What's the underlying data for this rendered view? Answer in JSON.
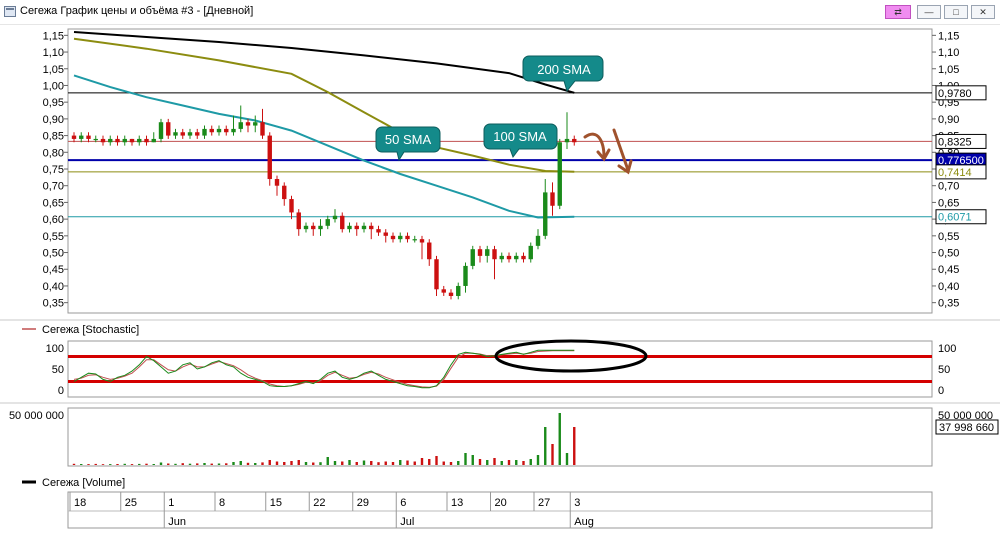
{
  "window": {
    "title": "Сегежа График цены и объёма #3 - [Дневной]",
    "buttons": {
      "link": "⇄",
      "minimize": "—",
      "maximize": "□",
      "close": "✕"
    }
  },
  "panels": {
    "stochastic_label": "Сегежа [Stochastic]",
    "volume_label": "Сегежа [Volume]"
  },
  "annotations": {
    "sma200": "200 SMA",
    "sma100": "100 SMA",
    "sma50": "50 SMA"
  },
  "colors": {
    "bull": "#1a8a1a",
    "bear": "#cc1010",
    "sma200": "#000000",
    "sma100": "#8c8c10",
    "sma50": "#1e9aa6",
    "blue_line": "#0000aa",
    "callout": "#148a8a",
    "stoch_band": "#d40000",
    "arrows": "#a0522d"
  },
  "chart_data": [
    {
      "type": "candlestick",
      "y_ticks": [
        "1,15",
        "1,10",
        "1,05",
        "1,00",
        "0,95",
        "0,90",
        "0,85",
        "0,80",
        "0,75",
        "0,70",
        "0,65",
        "0,60",
        "0,55",
        "0,50",
        "0,45",
        "0,40",
        "0,35"
      ],
      "ylim": [
        0.34,
        1.16
      ],
      "price_labels": [
        {
          "text": "0,9780",
          "value": 0.978,
          "color": "#000000",
          "bg": "#ffffff"
        },
        {
          "text": "0,8325",
          "value": 0.8325,
          "color": "#000000",
          "bg": "#ffffff"
        },
        {
          "text": "0,776500",
          "value": 0.7765,
          "color": "#ffffff",
          "bg": "#0000aa"
        },
        {
          "text": "0,7414",
          "value": 0.7414,
          "color": "#8c8c10",
          "bg": "#ffffff"
        },
        {
          "text": "0,6071",
          "value": 0.6071,
          "color": "#1e9aa6",
          "bg": "#ffffff"
        }
      ],
      "h_lines": [
        {
          "value": 0.978,
          "color": "#000000"
        },
        {
          "value": 0.8325,
          "color": "#c05050"
        },
        {
          "value": 0.7765,
          "color": "#0000aa"
        },
        {
          "value": 0.7414,
          "color": "#8c8c10"
        },
        {
          "value": 0.6071,
          "color": "#1e9aa6"
        }
      ],
      "candles": [
        [
          0.85,
          0.84,
          0.86,
          0.83
        ],
        [
          0.84,
          0.85,
          0.86,
          0.83
        ],
        [
          0.85,
          0.84,
          0.86,
          0.83
        ],
        [
          0.84,
          0.84,
          0.85,
          0.83
        ],
        [
          0.84,
          0.83,
          0.85,
          0.82
        ],
        [
          0.83,
          0.84,
          0.85,
          0.82
        ],
        [
          0.84,
          0.83,
          0.85,
          0.82
        ],
        [
          0.83,
          0.84,
          0.85,
          0.82
        ],
        [
          0.84,
          0.83,
          0.84,
          0.82
        ],
        [
          0.83,
          0.84,
          0.85,
          0.82
        ],
        [
          0.84,
          0.83,
          0.85,
          0.82
        ],
        [
          0.83,
          0.84,
          0.86,
          0.83
        ],
        [
          0.84,
          0.89,
          0.9,
          0.83
        ],
        [
          0.89,
          0.85,
          0.9,
          0.84
        ],
        [
          0.85,
          0.86,
          0.87,
          0.84
        ],
        [
          0.86,
          0.85,
          0.87,
          0.84
        ],
        [
          0.85,
          0.86,
          0.87,
          0.84
        ],
        [
          0.86,
          0.85,
          0.87,
          0.84
        ],
        [
          0.85,
          0.87,
          0.88,
          0.84
        ],
        [
          0.87,
          0.86,
          0.88,
          0.85
        ],
        [
          0.86,
          0.87,
          0.88,
          0.85
        ],
        [
          0.87,
          0.86,
          0.88,
          0.85
        ],
        [
          0.86,
          0.87,
          0.91,
          0.85
        ],
        [
          0.87,
          0.89,
          0.94,
          0.86
        ],
        [
          0.89,
          0.88,
          0.9,
          0.86
        ],
        [
          0.88,
          0.89,
          0.91,
          0.86
        ],
        [
          0.89,
          0.85,
          0.93,
          0.84
        ],
        [
          0.85,
          0.72,
          0.86,
          0.7
        ],
        [
          0.72,
          0.7,
          0.73,
          0.67
        ],
        [
          0.7,
          0.66,
          0.71,
          0.64
        ],
        [
          0.66,
          0.62,
          0.67,
          0.6
        ],
        [
          0.62,
          0.57,
          0.63,
          0.55
        ],
        [
          0.57,
          0.58,
          0.59,
          0.56
        ],
        [
          0.58,
          0.57,
          0.59,
          0.55
        ],
        [
          0.57,
          0.58,
          0.6,
          0.55
        ],
        [
          0.58,
          0.6,
          0.61,
          0.57
        ],
        [
          0.6,
          0.61,
          0.63,
          0.59
        ],
        [
          0.61,
          0.57,
          0.62,
          0.56
        ],
        [
          0.57,
          0.58,
          0.59,
          0.56
        ],
        [
          0.58,
          0.57,
          0.59,
          0.55
        ],
        [
          0.57,
          0.58,
          0.59,
          0.56
        ],
        [
          0.58,
          0.57,
          0.59,
          0.54
        ],
        [
          0.57,
          0.56,
          0.58,
          0.55
        ],
        [
          0.56,
          0.55,
          0.57,
          0.53
        ],
        [
          0.55,
          0.54,
          0.56,
          0.53
        ],
        [
          0.54,
          0.55,
          0.56,
          0.53
        ],
        [
          0.55,
          0.54,
          0.56,
          0.53
        ],
        [
          0.54,
          0.54,
          0.55,
          0.53
        ],
        [
          0.54,
          0.53,
          0.55,
          0.48
        ],
        [
          0.53,
          0.48,
          0.54,
          0.46
        ],
        [
          0.48,
          0.39,
          0.49,
          0.37
        ],
        [
          0.39,
          0.38,
          0.4,
          0.37
        ],
        [
          0.38,
          0.37,
          0.39,
          0.36
        ],
        [
          0.37,
          0.4,
          0.41,
          0.36
        ],
        [
          0.4,
          0.46,
          0.47,
          0.38
        ],
        [
          0.46,
          0.51,
          0.52,
          0.45
        ],
        [
          0.51,
          0.49,
          0.52,
          0.47
        ],
        [
          0.49,
          0.51,
          0.52,
          0.47
        ],
        [
          0.51,
          0.48,
          0.52,
          0.42
        ],
        [
          0.48,
          0.49,
          0.5,
          0.47
        ],
        [
          0.49,
          0.48,
          0.5,
          0.47
        ],
        [
          0.48,
          0.49,
          0.5,
          0.47
        ],
        [
          0.49,
          0.48,
          0.5,
          0.47
        ],
        [
          0.48,
          0.52,
          0.53,
          0.47
        ],
        [
          0.52,
          0.55,
          0.57,
          0.51
        ],
        [
          0.55,
          0.68,
          0.72,
          0.54
        ],
        [
          0.68,
          0.64,
          0.71,
          0.61
        ],
        [
          0.64,
          0.83,
          0.84,
          0.63
        ],
        [
          0.83,
          0.84,
          0.92,
          0.81
        ],
        [
          0.84,
          0.83,
          0.85,
          0.82
        ]
      ],
      "sma200": [
        [
          0,
          1.16
        ],
        [
          10,
          1.145
        ],
        [
          20,
          1.13
        ],
        [
          30,
          1.112
        ],
        [
          40,
          1.09
        ],
        [
          50,
          1.066
        ],
        [
          60,
          1.037
        ],
        [
          65,
          1.003
        ],
        [
          69,
          0.978
        ]
      ],
      "sma100": [
        [
          0,
          1.14
        ],
        [
          10,
          1.11
        ],
        [
          20,
          1.075
        ],
        [
          30,
          1.035
        ],
        [
          35,
          0.98
        ],
        [
          40,
          0.92
        ],
        [
          45,
          0.86
        ],
        [
          50,
          0.815
        ],
        [
          55,
          0.79
        ],
        [
          60,
          0.763
        ],
        [
          65,
          0.744
        ],
        [
          69,
          0.742
        ]
      ],
      "sma50": [
        [
          0,
          1.03
        ],
        [
          5,
          0.995
        ],
        [
          10,
          0.965
        ],
        [
          15,
          0.94
        ],
        [
          20,
          0.915
        ],
        [
          25,
          0.895
        ],
        [
          30,
          0.865
        ],
        [
          35,
          0.82
        ],
        [
          40,
          0.775
        ],
        [
          45,
          0.735
        ],
        [
          50,
          0.7
        ],
        [
          55,
          0.665
        ],
        [
          60,
          0.625
        ],
        [
          64,
          0.605
        ],
        [
          69,
          0.607
        ]
      ]
    },
    {
      "type": "line",
      "title": "Сегежа [Stochastic]",
      "y_ticks": [
        "100",
        "50",
        "0"
      ],
      "ylim": [
        -10,
        110
      ],
      "bands": [
        80,
        20
      ],
      "series_k": [
        20,
        30,
        40,
        38,
        25,
        20,
        30,
        35,
        45,
        60,
        80,
        70,
        55,
        40,
        45,
        60,
        65,
        50,
        55,
        65,
        70,
        60,
        55,
        40,
        30,
        25,
        20,
        10,
        8,
        8,
        10,
        15,
        20,
        15,
        25,
        40,
        45,
        30,
        25,
        30,
        40,
        45,
        35,
        25,
        20,
        15,
        10,
        8,
        5,
        5,
        10,
        30,
        60,
        85,
        90,
        88,
        85,
        80,
        82,
        85,
        88,
        90,
        85,
        90,
        95,
        95,
        95,
        95,
        95,
        95
      ],
      "series_d": [
        25,
        28,
        35,
        36,
        30,
        25,
        28,
        33,
        40,
        55,
        72,
        72,
        60,
        48,
        45,
        55,
        62,
        55,
        55,
        62,
        68,
        63,
        58,
        48,
        36,
        28,
        22,
        14,
        10,
        8,
        10,
        13,
        18,
        17,
        22,
        35,
        42,
        35,
        28,
        30,
        37,
        42,
        38,
        30,
        24,
        18,
        13,
        10,
        7,
        6,
        9,
        25,
        52,
        78,
        88,
        88,
        86,
        82,
        82,
        84,
        86,
        88,
        86,
        88,
        92,
        93,
        94,
        94,
        94,
        94
      ]
    },
    {
      "type": "bar",
      "title": "Сегежа [Volume]",
      "y_tick": "50 000 000",
      "last_value_label": "37 998 660",
      "ylim": [
        0,
        53000000
      ],
      "values": [
        1200000,
        1000000,
        900000,
        1100000,
        800000,
        900000,
        1000000,
        1200000,
        900000,
        1100000,
        1300000,
        1000000,
        2500000,
        1500000,
        1200000,
        1800000,
        1300000,
        1600000,
        2000000,
        1400000,
        1500000,
        1700000,
        3000000,
        4000000,
        2200000,
        2000000,
        2600000,
        5000000,
        3500000,
        3000000,
        4000000,
        5000000,
        3000000,
        2500000,
        2800000,
        8000000,
        4000000,
        3500000,
        5000000,
        3000000,
        4500000,
        4000000,
        2800000,
        3500000,
        3000000,
        5000000,
        4500000,
        3500000,
        7000000,
        6000000,
        9000000,
        3500000,
        3000000,
        4000000,
        12000000,
        10000000,
        6000000,
        5000000,
        7000000,
        4000000,
        5000000,
        5000000,
        4000000,
        6000000,
        10000000,
        38000000,
        21000000,
        52000000,
        12000000,
        37998660
      ],
      "bull": [
        0,
        1,
        0,
        0,
        0,
        1,
        0,
        1,
        0,
        1,
        0,
        1,
        1,
        0,
        1,
        0,
        1,
        0,
        1,
        0,
        1,
        0,
        1,
        1,
        0,
        1,
        0,
        0,
        0,
        0,
        0,
        0,
        1,
        0,
        1,
        1,
        1,
        0,
        1,
        0,
        1,
        0,
        0,
        0,
        0,
        1,
        0,
        0,
        0,
        0,
        0,
        0,
        0,
        1,
        1,
        1,
        0,
        1,
        0,
        1,
        0,
        1,
        0,
        1,
        1,
        1,
        0,
        1,
        1,
        0
      ]
    }
  ],
  "time_axis": {
    "day_labels": [
      "18",
      "25",
      "1",
      "8",
      "15",
      "22",
      "29",
      "6",
      "13",
      "20",
      "27",
      "3"
    ],
    "month_labels": [
      "Jun",
      "Jul",
      "Aug"
    ]
  }
}
